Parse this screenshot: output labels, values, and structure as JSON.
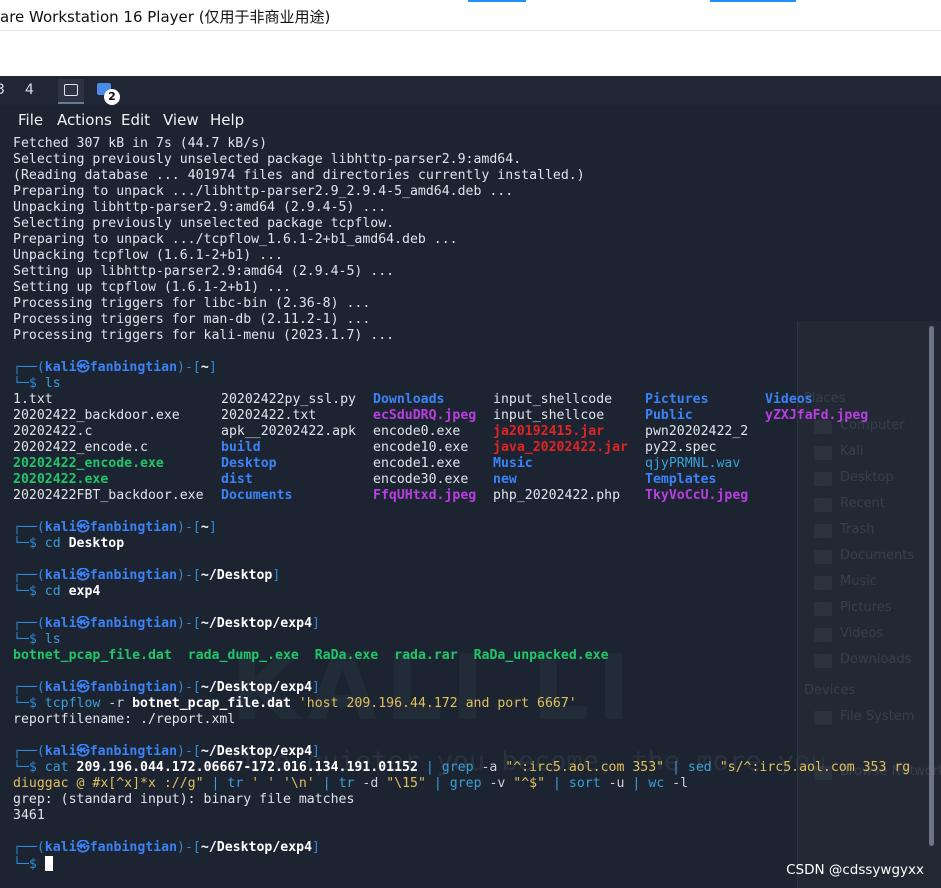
{
  "window": {
    "title": "are Workstation 16 Player (仅用于非商业用途)"
  },
  "taskbar": {
    "workspaces": [
      "3",
      "4"
    ],
    "badge": "2"
  },
  "menu": [
    "File",
    "Actions",
    "Edit",
    "View",
    "Help"
  ],
  "filemanager_ghost": {
    "places": "Places",
    "items": [
      "Computer",
      "Kali",
      "Desktop",
      "Recent",
      "Trash",
      "Documents",
      "Music",
      "Pictures",
      "Videos",
      "Downloads"
    ],
    "devices": "Devices",
    "device_items": [
      "File System"
    ],
    "network": "Browse Network"
  },
  "wallpaper": {
    "logo_text": "KALI LI",
    "quote": "\"the quieter you become, the more you"
  },
  "terminal": {
    "apt_output": [
      "Fetched 307 kB in 7s (44.7 kB/s)",
      "Selecting previously unselected package libhttp-parser2.9:amd64.",
      "(Reading database ... 401974 files and directories currently installed.)",
      "Preparing to unpack .../libhttp-parser2.9_2.9.4-5_amd64.deb ...",
      "Unpacking libhttp-parser2.9:amd64 (2.9.4-5) ...",
      "Selecting previously unselected package tcpflow.",
      "Preparing to unpack .../tcpflow_1.6.1-2+b1_amd64.deb ...",
      "Unpacking tcpflow (1.6.1-2+b1) ...",
      "Setting up libhttp-parser2.9:amd64 (2.9.4-5) ...",
      "Setting up tcpflow (1.6.1-2+b1) ...",
      "Processing triggers for libc-bin (2.36-8) ...",
      "Processing triggers for man-db (2.11.2-1) ...",
      "Processing triggers for kali-menu (2023.1.7) ..."
    ],
    "prompt": {
      "top_left": "┌──(",
      "user": "kali㉿fanbingtian",
      "mid": ")-[",
      "close": "]",
      "bottom": "└─$ "
    },
    "blocks": [
      {
        "path": "~",
        "cmd": "ls",
        "cmd_parts": [
          {
            "t": "ls",
            "c": "cyan"
          }
        ]
      },
      {
        "path": "~",
        "cmd_parts": [
          {
            "t": "cd ",
            "c": "cyan"
          },
          {
            "t": "Desktop",
            "c": "white-b"
          }
        ]
      },
      {
        "path": "~/Desktop",
        "cmd_parts": [
          {
            "t": "cd ",
            "c": "cyan"
          },
          {
            "t": "exp4",
            "c": "white-b"
          }
        ]
      },
      {
        "path": "~/Desktop/exp4",
        "cmd_parts": [
          {
            "t": "ls",
            "c": "cyan"
          }
        ]
      },
      {
        "path": "~/Desktop/exp4",
        "cmd_parts": [
          {
            "t": "tcpflow",
            "c": "cyan"
          },
          {
            "t": " -r ",
            "c": "gray"
          },
          {
            "t": "botnet_pcap_file.dat",
            "c": "white-b"
          },
          {
            "t": " 'host 209.196.44.172 and port 6667'",
            "c": "yellow"
          }
        ]
      },
      {
        "path": "~/Desktop/exp4"
      },
      {
        "path": "~/Desktop/exp4"
      }
    ],
    "ls_home": [
      [
        {
          "t": "1.txt",
          "c": "plain"
        },
        {
          "t": "20202422py_ssl.py",
          "c": "plain"
        },
        {
          "t": "Downloads",
          "c": "blue-b"
        },
        {
          "t": "input_shellcode",
          "c": "plain"
        },
        {
          "t": "Pictures",
          "c": "blue-b"
        },
        {
          "t": "Videos",
          "c": "blue-b"
        }
      ],
      [
        {
          "t": "20202422_backdoor.exe",
          "c": "plain"
        },
        {
          "t": "20202422.txt",
          "c": "plain"
        },
        {
          "t": "ecSduDRQ.jpeg",
          "c": "purple-b"
        },
        {
          "t": "input_shellcoe",
          "c": "plain"
        },
        {
          "t": "Public",
          "c": "blue-b"
        },
        {
          "t": "yZXJfaFd.jpeg",
          "c": "purple-b"
        }
      ],
      [
        {
          "t": "20202422.c",
          "c": "plain"
        },
        {
          "t": "apk__20202422.apk",
          "c": "plain"
        },
        {
          "t": "encode0.exe",
          "c": "plain"
        },
        {
          "t": "ja20192415.jar",
          "c": "red-b"
        },
        {
          "t": "pwn20202422_2",
          "c": "plain"
        },
        {
          "t": "",
          "c": "plain"
        }
      ],
      [
        {
          "t": "20202422_encode.c",
          "c": "plain"
        },
        {
          "t": "build",
          "c": "blue-b"
        },
        {
          "t": "encode10.exe",
          "c": "plain"
        },
        {
          "t": "java_20202422.jar",
          "c": "red-b"
        },
        {
          "t": "py22.spec",
          "c": "plain"
        },
        {
          "t": "",
          "c": "plain"
        }
      ],
      [
        {
          "t": "20202422_encode.exe",
          "c": "green-b"
        },
        {
          "t": "Desktop",
          "c": "blue-b"
        },
        {
          "t": "encode1.exe",
          "c": "plain"
        },
        {
          "t": "Music",
          "c": "blue-b"
        },
        {
          "t": "qjyPRMNL.wav",
          "c": "cyan"
        },
        {
          "t": "",
          "c": "plain"
        }
      ],
      [
        {
          "t": "20202422.exe",
          "c": "green-b"
        },
        {
          "t": "dist",
          "c": "blue-b"
        },
        {
          "t": "encode30.exe",
          "c": "plain"
        },
        {
          "t": "new",
          "c": "blue-b"
        },
        {
          "t": "Templates",
          "c": "blue-b"
        },
        {
          "t": "",
          "c": "plain"
        }
      ],
      [
        {
          "t": "20202422FBT_backdoor.exe",
          "c": "plain"
        },
        {
          "t": "Documents",
          "c": "blue-b"
        },
        {
          "t": "FfqUHtxd.jpeg",
          "c": "purple-b"
        },
        {
          "t": "php_20202422.php",
          "c": "plain"
        },
        {
          "t": "TkyVoCcU.jpeg",
          "c": "purple-b"
        },
        {
          "t": "",
          "c": "plain"
        }
      ]
    ],
    "ls_exp4": [
      {
        "t": "botnet_pcap_file.dat",
        "c": "green-b"
      },
      {
        "t": "rada_dump_.exe",
        "c": "green-b"
      },
      {
        "t": "RaDa.exe",
        "c": "green-b"
      },
      {
        "t": "rada.rar",
        "c": "green-b"
      },
      {
        "t": "RaDa_unpacked.exe",
        "c": "green-b"
      }
    ],
    "tcpflow_output": "reportfilename: ./report.xml",
    "pipeline_line1": [
      {
        "t": "cat ",
        "c": "cyan"
      },
      {
        "t": "209.196.044.172.06667-172.016.134.191.01152",
        "c": "white-b"
      },
      {
        "t": " | ",
        "c": "cyan"
      },
      {
        "t": "grep",
        "c": "cyan"
      },
      {
        "t": " -a ",
        "c": "gray"
      },
      {
        "t": "\"^:irc5.aol.com 353\"",
        "c": "yellow"
      },
      {
        "t": " | ",
        "c": "cyan"
      },
      {
        "t": "sed",
        "c": "cyan"
      },
      {
        "t": " \"s/^:irc5.aol.com 353 rg",
        "c": "yellow"
      }
    ],
    "pipeline_line2": [
      {
        "t": "diuggac @ #x[^x]*x ://g\"",
        "c": "yellow"
      },
      {
        "t": " | ",
        "c": "cyan"
      },
      {
        "t": "tr",
        "c": "cyan"
      },
      {
        "t": " ' ' '\\n'",
        "c": "yellow"
      },
      {
        "t": " | ",
        "c": "cyan"
      },
      {
        "t": "tr",
        "c": "cyan"
      },
      {
        "t": " -d ",
        "c": "gray"
      },
      {
        "t": "\"\\15\"",
        "c": "yellow"
      },
      {
        "t": " | ",
        "c": "cyan"
      },
      {
        "t": "grep",
        "c": "cyan"
      },
      {
        "t": " -v ",
        "c": "gray"
      },
      {
        "t": "\"^$\"",
        "c": "yellow"
      },
      {
        "t": " | ",
        "c": "cyan"
      },
      {
        "t": "sort",
        "c": "cyan"
      },
      {
        "t": " -u ",
        "c": "gray"
      },
      {
        "t": "| ",
        "c": "cyan"
      },
      {
        "t": "wc",
        "c": "cyan"
      },
      {
        "t": " -l",
        "c": "gray"
      }
    ],
    "grep_output": "grep: (standard input): binary file matches",
    "count_output": "3461"
  },
  "watermark": "CSDN @cdssywgyxx",
  "colors": {
    "terminal_bg": "#1d2431",
    "dir_blue": "#3b82f6",
    "exec_green": "#20c56a",
    "archive_red": "#e02424",
    "image_purple": "#b83fe0",
    "string_yellow": "#e0c05a"
  }
}
